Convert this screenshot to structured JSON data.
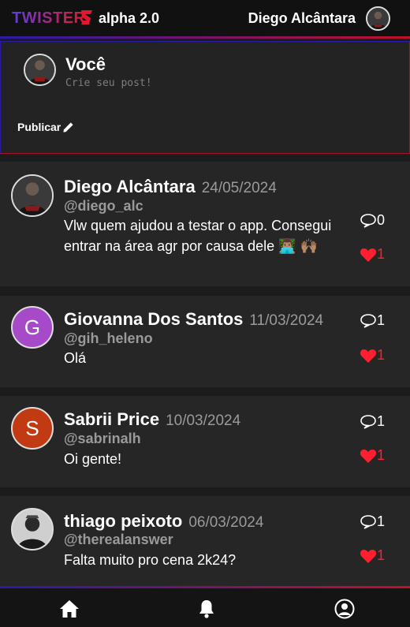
{
  "header": {
    "logo_text": "TWISTER",
    "version": "alpha 2.0",
    "user_name": "Diego Alcântara",
    "colors": {
      "gradient_start": "#2a1aa8",
      "gradient_end": "#c0102a"
    }
  },
  "composer": {
    "name": "Você",
    "placeholder": "Crie seu post!",
    "publish_label": "Publicar",
    "publish_icon": "pencil-icon"
  },
  "posts": [
    {
      "name": "Diego Alcântara",
      "date": "24/05/2024",
      "handle": "@diego_alc",
      "text": "Vlw quem ajudou a testar o app. Consegui entrar na área agr por causa dele 👨🏽‍💻 🙌🏽",
      "comments": "0",
      "likes": "1",
      "avatar": {
        "type": "photo"
      }
    },
    {
      "name": "Giovanna Dos Santos",
      "date": "11/03/2024",
      "handle": "@gih_heleno",
      "text": "Olá",
      "comments": "1",
      "likes": "1",
      "avatar": {
        "type": "letter",
        "letter": "G",
        "color": "#a64ac9"
      }
    },
    {
      "name": "Sabrii Price",
      "date": "10/03/2024",
      "handle": "@sabrinalh",
      "text": "Oi gente!",
      "comments": "1",
      "likes": "1",
      "avatar": {
        "type": "letter",
        "letter": "S",
        "color": "#c23a12"
      }
    },
    {
      "name": "thiago peixoto",
      "date": "06/03/2024",
      "handle": "@therealanswer",
      "text": "Falta muito pro cena 2k24?",
      "comments": "1",
      "likes": "1",
      "avatar": {
        "type": "photo"
      }
    }
  ],
  "nav": {
    "items": [
      "home-icon",
      "bell-icon",
      "profile-icon"
    ]
  },
  "colors": {
    "background": "#1c1c1c",
    "card": "#262626",
    "like": "#ff1f2e",
    "muted": "#9a9a9a"
  }
}
